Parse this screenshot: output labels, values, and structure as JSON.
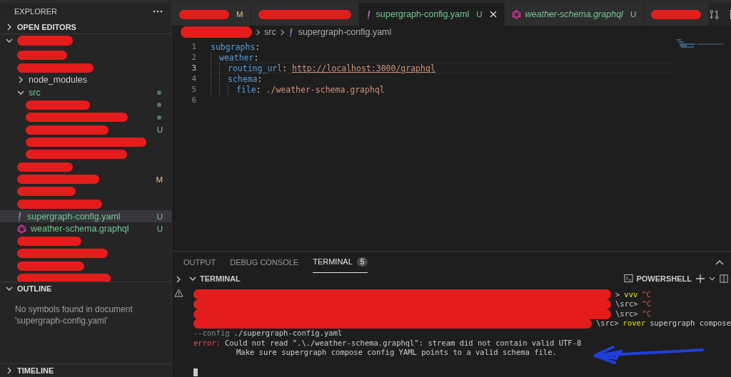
{
  "sidebar": {
    "title": "EXPLORER",
    "sections": [
      {
        "label": "OPEN EDITORS",
        "expanded": false
      }
    ],
    "workspace": {
      "expanded": true
    },
    "tree": [
      {
        "kind": "redacted"
      },
      {
        "kind": "redacted"
      },
      {
        "kind": "folder",
        "label": "node_modules",
        "expanded": false,
        "changed": false
      },
      {
        "kind": "folder",
        "label": "src",
        "expanded": true,
        "changed": true,
        "children": [
          {
            "kind": "redacted",
            "changed": true
          },
          {
            "kind": "redacted",
            "changed": true
          },
          {
            "kind": "redacted",
            "badge": "U"
          },
          {
            "kind": "redacted"
          },
          {
            "kind": "redacted"
          }
        ]
      },
      {
        "kind": "redacted"
      },
      {
        "kind": "redacted",
        "badge": "M"
      },
      {
        "kind": "redacted"
      },
      {
        "kind": "redacted"
      },
      {
        "kind": "yaml-file",
        "label": "supergraph-config.yaml",
        "badge": "U",
        "selected": true
      },
      {
        "kind": "graphql-file",
        "label": "weather-schema.graphql",
        "badge": "U",
        "selected": false
      },
      {
        "kind": "redacted"
      },
      {
        "kind": "redacted"
      },
      {
        "kind": "redacted"
      },
      {
        "kind": "redacted"
      }
    ],
    "outline": {
      "label": "OUTLINE",
      "expanded": true,
      "message": "No symbols found in document 'supergraph-config.yaml'"
    },
    "timeline": {
      "label": "TIMELINE",
      "expanded": false
    }
  },
  "tabs": [
    {
      "kind": "redacted",
      "badge": "M",
      "selected": false
    },
    {
      "kind": "redacted",
      "selected": false
    },
    {
      "kind": "yaml-file",
      "label": "supergraph-config.yaml",
      "badge": "U",
      "selected": true,
      "preview": false
    },
    {
      "kind": "graphql-file",
      "label": "weather-schema.graphql",
      "badge": "U",
      "selected": false,
      "preview": true
    },
    {
      "kind": "redacted",
      "selected": false
    }
  ],
  "breadcrumbs": [
    {
      "kind": "redacted"
    },
    {
      "kind": "folder",
      "label": "src"
    },
    {
      "kind": "yaml-file",
      "label": "supergraph-config.yaml"
    }
  ],
  "code": [
    {
      "number": "1",
      "current": false,
      "tokens": [
        {
          "kind": "key",
          "text": "subgraphs"
        },
        {
          "kind": "punct",
          "text": ":"
        }
      ],
      "children": [
        {
          "number": "2",
          "current": false,
          "tokens": [
            {
              "kind": "key",
              "text": "weather"
            },
            {
              "kind": "punct",
              "text": ":"
            }
          ],
          "children": [
            {
              "number": "3",
              "current": true,
              "tokens": [
                {
                  "kind": "key",
                  "text": "routing_url"
                },
                {
                  "kind": "punct",
                  "text": ": "
                },
                {
                  "kind": "url",
                  "text": "http://localhost:3000/graphql"
                }
              ]
            },
            {
              "number": "4",
              "current": false,
              "tokens": [
                {
                  "kind": "key",
                  "text": "schema"
                },
                {
                  "kind": "punct",
                  "text": ":"
                }
              ],
              "children": [
                {
                  "number": "5",
                  "current": false,
                  "tokens": [
                    {
                      "kind": "key",
                      "text": "file"
                    },
                    {
                      "kind": "punct",
                      "text": ": "
                    },
                    {
                      "kind": "string",
                      "text": "./weather-schema.graphql"
                    }
                  ]
                }
              ]
            }
          ]
        }
      ]
    },
    {
      "number": "6",
      "current": false
    }
  ],
  "panel": {
    "tabs": [
      {
        "label": "OUTPUT",
        "selected": false
      },
      {
        "label": "DEBUG CONSOLE",
        "selected": false
      },
      {
        "label": "TERMINAL",
        "selected": true,
        "badge": "5"
      }
    ],
    "terminal_header": {
      "label": "TERMINAL",
      "expanded": true,
      "shell": "POWERSHELL"
    },
    "lines": [
      {
        "tokens": [
          {
            "kind": "redacted"
          },
          {
            "kind": "prompt",
            "text": ">"
          },
          {
            "kind": "command",
            "text": "vvv"
          },
          {
            "kind": "ctrl",
            "text": "^C"
          }
        ]
      },
      {
        "tokens": [
          {
            "kind": "redacted"
          },
          {
            "kind": "prompt",
            "text": "\\src>"
          },
          {
            "kind": "ctrl",
            "text": "^C"
          }
        ]
      },
      {
        "tokens": [
          {
            "kind": "redacted"
          },
          {
            "kind": "prompt",
            "text": "\\src>"
          },
          {
            "kind": "ctrl",
            "text": "^C"
          }
        ]
      },
      {
        "tokens": [
          {
            "kind": "redacted"
          },
          {
            "kind": "prompt",
            "text": "\\src>"
          },
          {
            "kind": "command",
            "text": "rover"
          },
          {
            "kind": "plain",
            "text": "supergraph compose"
          }
        ]
      },
      {
        "tokens": [
          {
            "kind": "dim",
            "text": "--config"
          },
          {
            "kind": "plain",
            "text": "./supergraph-config.yaml"
          }
        ]
      },
      {
        "tokens": [
          {
            "kind": "error",
            "text": "error:"
          },
          {
            "kind": "plain",
            "text": "Could not read \".\\./weather-schema.graphql\": stream did not contain valid UTF-8"
          }
        ]
      },
      {
        "tokens": [
          {
            "kind": "indent"
          },
          {
            "kind": "plain",
            "text": "Make sure supergraph compose config YAML points to a valid schema file."
          }
        ]
      },
      {
        "tokens": [
          {
            "kind": "cursor"
          }
        ]
      }
    ]
  }
}
